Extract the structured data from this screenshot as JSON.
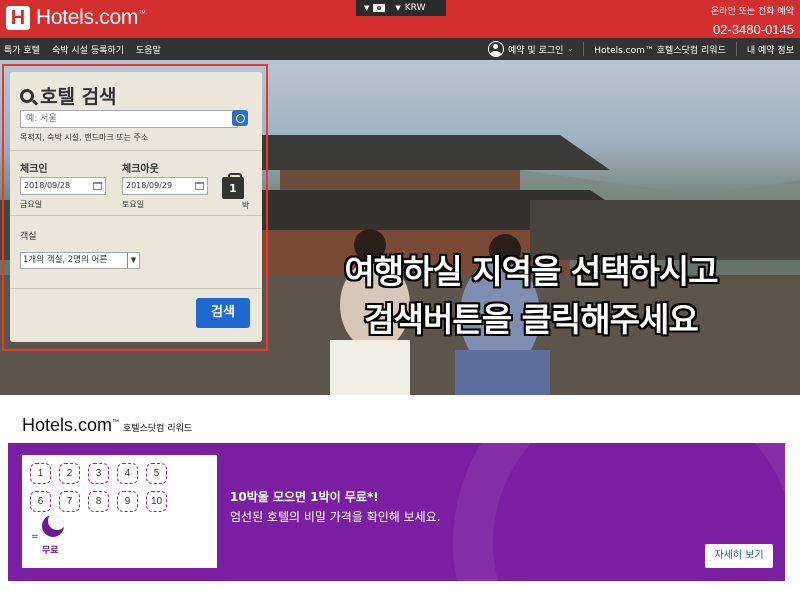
{
  "header": {
    "logo_letter": "H",
    "logo_text": "Hotels.com",
    "logo_tm": "™",
    "locale": {
      "currency": "KRW"
    },
    "contact_label": "온라인 또는 전화 예약",
    "phone": "02-3480-0145",
    "brand_color": "#d32f2f"
  },
  "nav": {
    "left": [
      "특가 호텔",
      "숙박 시설 등록하기",
      "도움말"
    ],
    "login": "예약 및 로그인",
    "rewards": "Hotels.com™ 호텔스닷컴 리워드",
    "my_bookings": "내 예약 정보"
  },
  "hero": {
    "line1": "여행하실 지역을 선택하시고",
    "line2": "검색버튼을 클릭해주세요"
  },
  "search": {
    "title": "호텔 검색",
    "destination_placeholder": "예: 서울",
    "destination_hint": "목적지, 숙박 시설, 랜드마크 또는 주소",
    "checkin_label": "체크인",
    "checkin_value": "2018/09/28",
    "checkin_day": "금요일",
    "checkout_label": "체크아웃",
    "checkout_value": "2018/09/29",
    "checkout_day": "토요일",
    "nights": "1",
    "nights_label": "박",
    "rooms_label": "객실",
    "rooms_value": "1개의 객실, 2명의 어른",
    "button": "검색"
  },
  "rewards": {
    "logo": "Hotels.com",
    "logo_tm": "™",
    "subtitle": "호텔스닷컴 리워드",
    "stamps": [
      "1",
      "2",
      "3",
      "4",
      "5",
      "6",
      "7",
      "8",
      "9",
      "10"
    ],
    "equals": "=",
    "free_label": "무료",
    "title": "10박을 모으면 1박이 무료*!",
    "description": "엄선된 호텔의 비밀 가격을 확인해 보세요.",
    "button": "자세히 보기",
    "accent_color": "#7b1fa2"
  }
}
